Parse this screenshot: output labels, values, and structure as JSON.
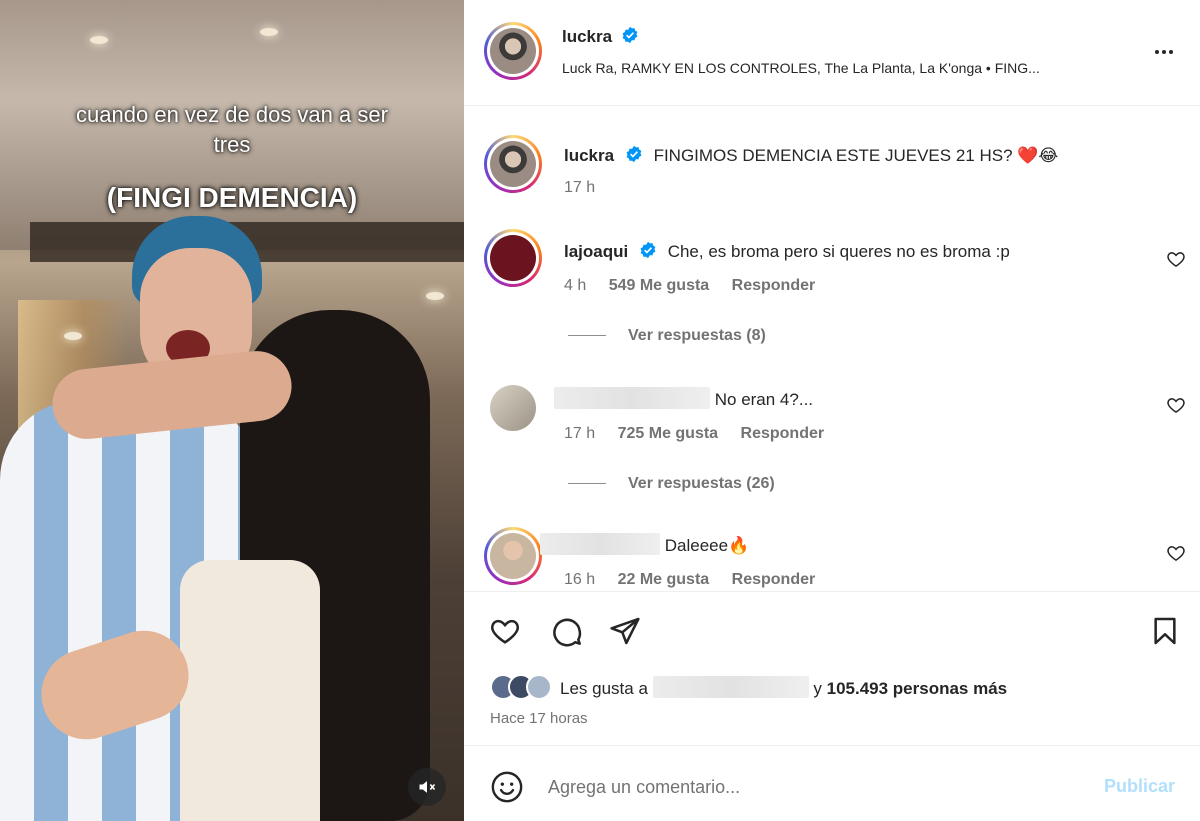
{
  "media": {
    "caption_line1": "cuando en vez de dos van a ser tres",
    "caption_line2": "(FINGI DEMENCIA)",
    "mute_icon": "speaker-muted-icon"
  },
  "post": {
    "author": "luckra",
    "verified": true,
    "audio": "Luck Ra, RAMKY EN LOS CONTROLES, The La Planta, La K'onga • FING..."
  },
  "caption": {
    "username": "luckra",
    "text": "FINGIMOS DEMENCIA ESTE JUEVES 21 HS? ❤️😂",
    "time": "17 h"
  },
  "comments": [
    {
      "username": "lajoaqui",
      "verified": true,
      "text": "Che, es broma pero si queres no es broma :p",
      "time": "4 h",
      "likes": "549 Me gusta",
      "reply": "Responder",
      "view_replies": "Ver respuestas (8)"
    },
    {
      "username": "",
      "verified": false,
      "text": "No eran 4?...",
      "time": "17 h",
      "likes": "725 Me gusta",
      "reply": "Responder",
      "view_replies": "Ver respuestas (26)"
    },
    {
      "username": "",
      "verified": false,
      "text": "Daleeee🔥",
      "time": "16 h",
      "likes": "22 Me gusta",
      "reply": "Responder"
    }
  ],
  "likes_summary": {
    "prefix": "Les gusta a",
    "joiner": "y",
    "others": "105.493 personas más"
  },
  "time_ago": "Hace 17 horas",
  "composer": {
    "placeholder": "Agrega un comentario...",
    "publish_label": "Publicar"
  },
  "colors": {
    "verified": "#0095f6",
    "like_red": "#ed4956",
    "publish_disabled": "#b2dffc",
    "muted_text": "#737373"
  }
}
